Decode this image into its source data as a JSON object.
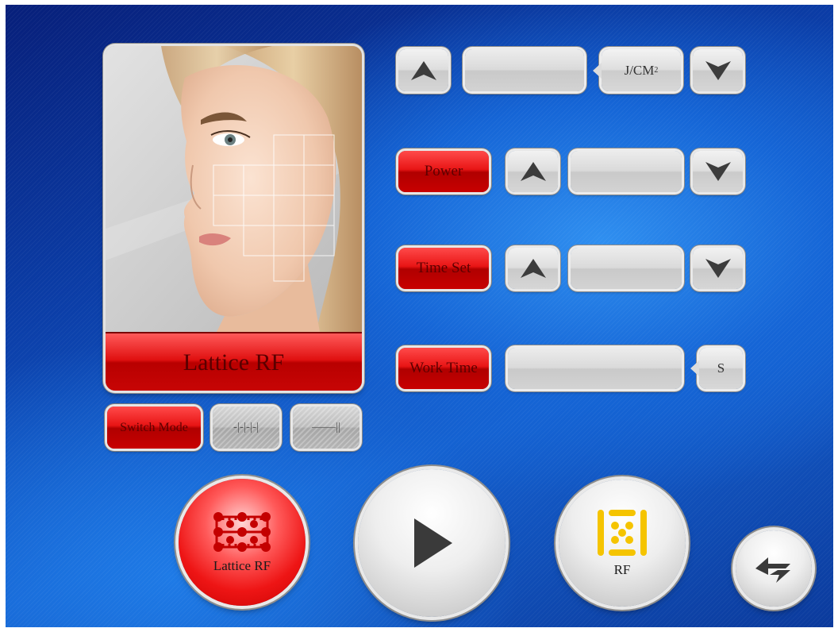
{
  "mode_panel": {
    "title": "Lattice RF",
    "switch_mode_label": "Switch Mode",
    "pattern_dotted_label": "-|-|-|-|",
    "pattern_solid_label": "——||"
  },
  "controls": {
    "energy": {
      "value": "",
      "unit": "J/CM",
      "unit_sup": "2"
    },
    "power": {
      "label": "Power",
      "value": ""
    },
    "time_set": {
      "label": "Time Set",
      "value": ""
    },
    "work_time": {
      "label": "Work Time",
      "value": "",
      "unit": "S"
    }
  },
  "bottom_bar": {
    "lattice_rf_label": "Lattice RF",
    "rf_label": "RF"
  },
  "colors": {
    "accent_red": "#e01010",
    "background_blue": "#1460cf",
    "rf_icon_yellow": "#f5c400"
  },
  "icons": [
    "up-arrow-icon",
    "down-arrow-icon",
    "play-icon",
    "lattice-grid-icon",
    "rf-dots-icon",
    "back-arrow-icon"
  ]
}
